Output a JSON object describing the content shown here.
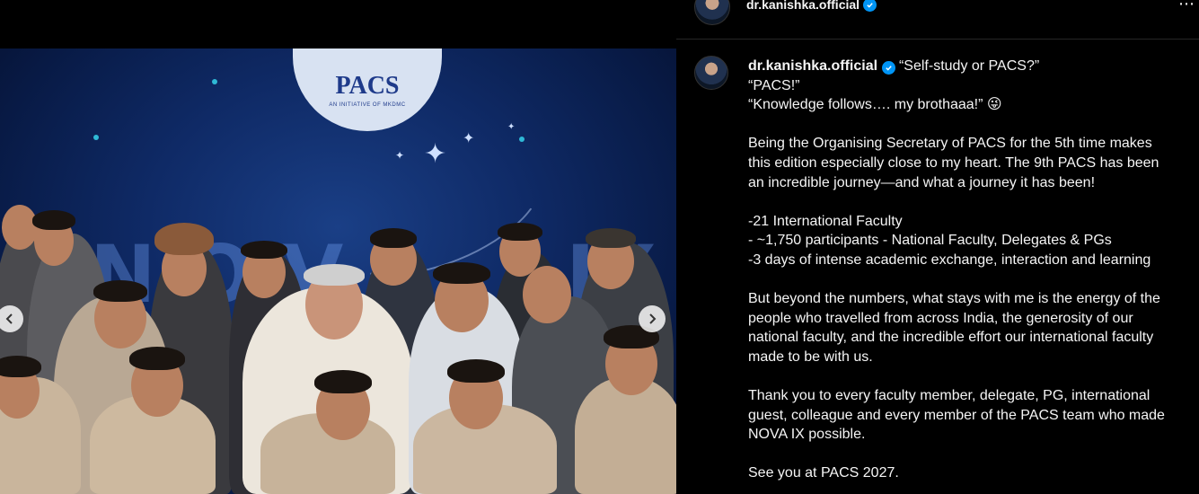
{
  "post": {
    "username": "dr.kanishka.official",
    "verified": true,
    "caption_lines": [
      "“Self-study or PACS?”",
      "“PACS!”",
      "“Knowledge follows…. my brothaaa!” 😜",
      "",
      "Being the Organising Secretary of PACS for the 5th time makes",
      "this edition especially close to my heart. The 9th PACS has been",
      "an incredible journey—and what a journey it has been!",
      "",
      "-21 International Faculty",
      "- ~1,750 participants - National Faculty, Delegates & PGs",
      "-3 days of intense academic exchange, interaction and learning",
      "",
      "But beyond the numbers, what stays with me is the energy of the",
      "people who travelled from across India, the generosity of our",
      "national faculty, and the incredible effort our international faculty",
      "made to be with us.",
      "",
      "Thank you to every faculty member, delegate, PG, international",
      "guest, colleague and every member of the PACS team who made",
      "NOVA IX possible.",
      "",
      "See you at PACS 2027."
    ]
  },
  "media": {
    "logo_text": "PACS",
    "logo_subtext": "AN INITIATIVE OF MKDMC",
    "banner_left": "NOVA",
    "banner_right": "IX"
  },
  "colors": {
    "background": "#000000",
    "text": "#f5f5f5",
    "verified_badge": "#0095f6",
    "banner_blue": "#0f2a66"
  },
  "icons": {
    "prev": "chevron-left-icon",
    "next": "chevron-right-icon",
    "more": "more-options-icon",
    "verified": "verified-badge-icon"
  }
}
